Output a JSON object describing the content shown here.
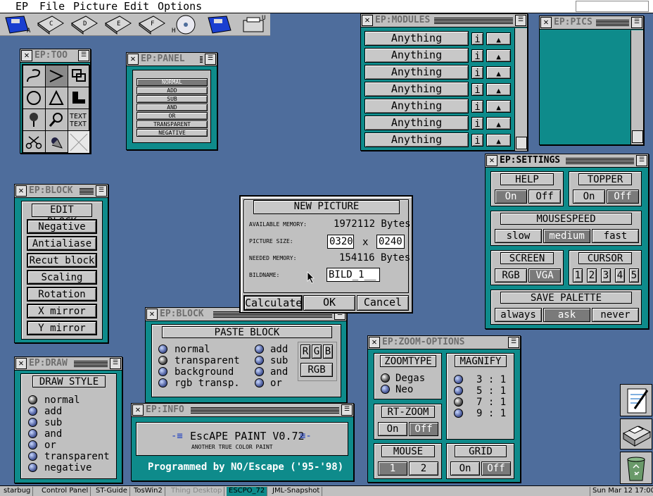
{
  "menubar": {
    "items": [
      "EP",
      "File",
      "Picture",
      "Edit",
      "Options"
    ]
  },
  "drives": [
    "A",
    "C",
    "D",
    "E",
    "F",
    "H",
    "U"
  ],
  "tools_window": {
    "title": "EP:TOO"
  },
  "panel_window": {
    "title": "EP:PANEL",
    "items": [
      "NORMAL",
      "ADD",
      "SUB",
      "AND",
      "OR",
      "TRANSPARENT",
      "NEGATIVE"
    ]
  },
  "modules_window": {
    "title": "EP:MODULES",
    "items": [
      "Anything",
      "Anything",
      "Anything",
      "Anything",
      "Anything",
      "Anything",
      "Anything"
    ],
    "info_label": "i",
    "eject_label": "▲"
  },
  "pics_window": {
    "title": "EP:PICS"
  },
  "block_window": {
    "title": "EP:BLOCK",
    "header": "EDIT BLOCK",
    "buttons": [
      "Negative",
      "Antialiase",
      "Recut block",
      "Scaling",
      "Rotation",
      "X mirror",
      "Y mirror"
    ]
  },
  "new_picture": {
    "header": "NEW PICTURE",
    "available_label": "AVAILABLE MEMORY:",
    "available_value": "1972112 Bytes",
    "size_label": "PICTURE SIZE:",
    "width": "0320",
    "x": "x",
    "height": "0240",
    "needed_label": "NEEDED MEMORY:",
    "needed_value": "154116 Bytes",
    "name_label": "BILDNAME:",
    "name_value": "BILD_1__",
    "calculate": "Calculate",
    "ok": "OK",
    "cancel": "Cancel"
  },
  "paste_window": {
    "title": "EP:BLOCK",
    "header": "PASTE BLOCK",
    "left_options": [
      "normal",
      "transparent",
      "background",
      "rgb transp."
    ],
    "right_options": [
      "add",
      "sub",
      "and",
      "or"
    ],
    "r": "R",
    "g": "G",
    "b": "B",
    "rgb": "RGB"
  },
  "settings_window": {
    "title": "EP:SETTINGS",
    "help": "HELP",
    "on": "On",
    "off": "Off",
    "topper": "TOPPER",
    "mousespeed": "MOUSESPEED",
    "slow": "slow",
    "medium": "medium",
    "fast": "fast",
    "screen": "SCREEN",
    "rgb": "RGB",
    "vga": "VGA",
    "cursor": "CURSOR",
    "cursor_values": [
      "1",
      "2",
      "3",
      "4",
      "5"
    ],
    "save_palette": "SAVE PALETTE",
    "always": "always",
    "ask": "ask",
    "never": "never"
  },
  "draw_window": {
    "title": "EP:DRAW",
    "header": "DRAW STYLE",
    "options": [
      "normal",
      "add",
      "sub",
      "and",
      "or",
      "transparent",
      "negative"
    ]
  },
  "info_window": {
    "title": "EP:INFO",
    "app_name": "EscAPE PAINT V0.72",
    "tagline": "ANOTHER TRUE COLOR PAINT",
    "credit": "Programmed by NO/Escape ('95-'98)"
  },
  "zoom_window": {
    "title": "EP:ZOOM-OPTIONS",
    "zoomtype": "ZOOMTYPE",
    "degas": "Degas",
    "neo": "Neo",
    "magnify": "MAGNIFY",
    "magnify_values": [
      "3 : 1",
      "5 : 1",
      "7 : 1",
      "9 : 1"
    ],
    "rtzoom": "RT-ZOOM",
    "on": "On",
    "off": "Off",
    "mouse": "MOUSE",
    "one": "1",
    "two": "2",
    "grid": "GRID"
  },
  "taskbar": {
    "items": [
      "starbug",
      "Control Panel",
      "ST-Guide",
      "TosWin2",
      "Thing Desktop",
      "ESCPO_72",
      "JML-Snapshot"
    ],
    "clock": "Sun Mar 12 17:00"
  }
}
